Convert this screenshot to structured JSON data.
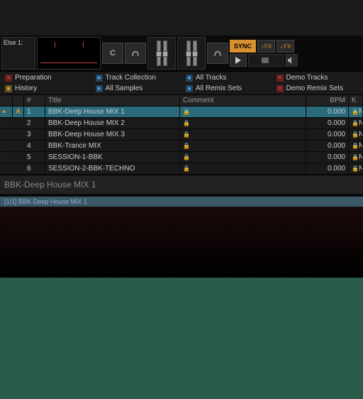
{
  "header": {
    "else_label": "Else 1:",
    "c_btn": "C",
    "sync": "SYNC",
    "fx": "FX"
  },
  "favorites": [
    {
      "icon": "red",
      "label": "Preparation"
    },
    {
      "icon": "blue",
      "label": "Track Collection"
    },
    {
      "icon": "blue",
      "label": "All Tracks"
    },
    {
      "icon": "red",
      "label": "Demo Tracks"
    },
    {
      "icon": "yellow",
      "label": "History"
    },
    {
      "icon": "blue",
      "label": "All Samples"
    },
    {
      "icon": "blue",
      "label": "All Remix Sets"
    },
    {
      "icon": "red",
      "label": "Demo Remix Sets"
    }
  ],
  "columns": {
    "num": "#",
    "title": "Title",
    "comment": "Comment",
    "bpm": "BPM",
    "key": "K"
  },
  "tracks": [
    {
      "letter": "A",
      "num": "1",
      "title": "BBK-Deep House MIX 1",
      "comment": "",
      "bpm": "0.000",
      "key": "N",
      "selected": true
    },
    {
      "letter": "",
      "num": "2",
      "title": "BBK-Deep House MIX 2",
      "comment": "",
      "bpm": "0.000",
      "key": "N",
      "selected": false
    },
    {
      "letter": "",
      "num": "3",
      "title": "BBK-Deep House MIX 3",
      "comment": "",
      "bpm": "0.000",
      "key": "N",
      "selected": false
    },
    {
      "letter": "",
      "num": "4",
      "title": "BBK-Trance MIX",
      "comment": "",
      "bpm": "0.000",
      "key": "N",
      "selected": false
    },
    {
      "letter": "",
      "num": "5",
      "title": "SESSION-1-BBK",
      "comment": "",
      "bpm": "0.000",
      "key": "N",
      "selected": false
    },
    {
      "letter": "",
      "num": "6",
      "title": "SESSION-2-BBK-TECHNO",
      "comment": "",
      "bpm": "0.000",
      "key": "N",
      "selected": false
    }
  ],
  "detail": {
    "title": "BBK-Deep House MIX 1",
    "sub": "[1/1]  BBK-Deep House MIX 1"
  }
}
